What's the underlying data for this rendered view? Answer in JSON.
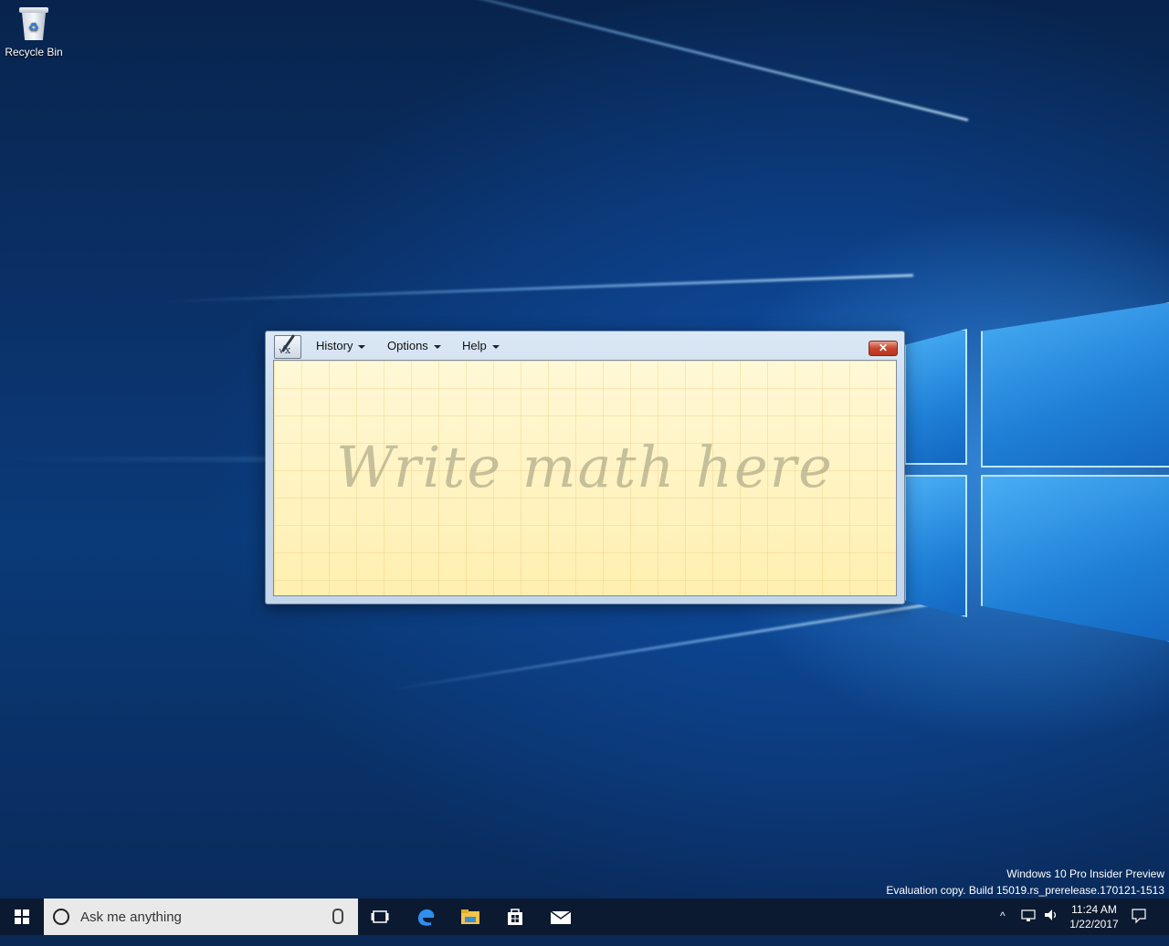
{
  "desktop": {
    "icons": [
      {
        "label": "Recycle Bin"
      }
    ],
    "watermark": {
      "line1": "Windows 10 Pro Insider Preview",
      "line2": "Evaluation copy. Build 15019.rs_prerelease.170121-1513"
    }
  },
  "math_panel": {
    "menus": [
      {
        "label": "History"
      },
      {
        "label": "Options"
      },
      {
        "label": "Help"
      }
    ],
    "close_label": "✕",
    "hint_text": "Write math here"
  },
  "taskbar": {
    "search_placeholder": "Ask me anything",
    "pinned": [
      "task-view",
      "edge",
      "file-explorer",
      "store",
      "mail"
    ],
    "clock": {
      "time": "11:24 AM",
      "date": "1/22/2017"
    }
  },
  "colors": {
    "accent": "#1f7fd6",
    "close_red": "#c8452f",
    "writing_area": "#fff3c2"
  }
}
